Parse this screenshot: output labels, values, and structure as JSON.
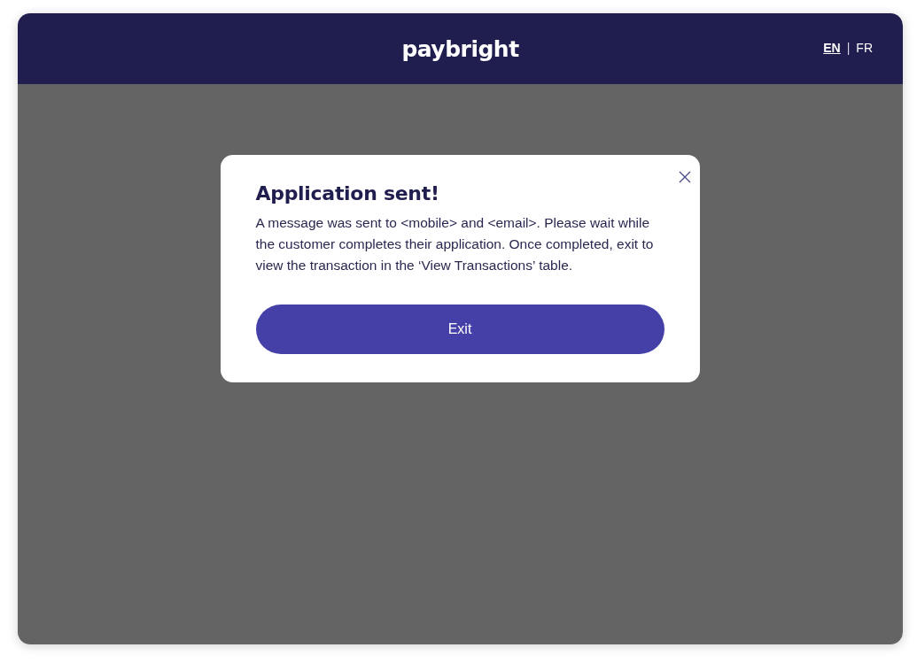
{
  "header": {
    "logo": "paybright",
    "languages": [
      {
        "label": "EN",
        "selected": true
      },
      {
        "label": "FR",
        "selected": false
      }
    ],
    "language_separator": "|"
  },
  "dialog": {
    "title": "Application sent!",
    "message": "A message was sent to <mobile> and <email>. Please wait while the customer completes their application. Once completed, exit to view the transaction in the ‘View Transactions’ table.",
    "button": "Exit"
  }
}
